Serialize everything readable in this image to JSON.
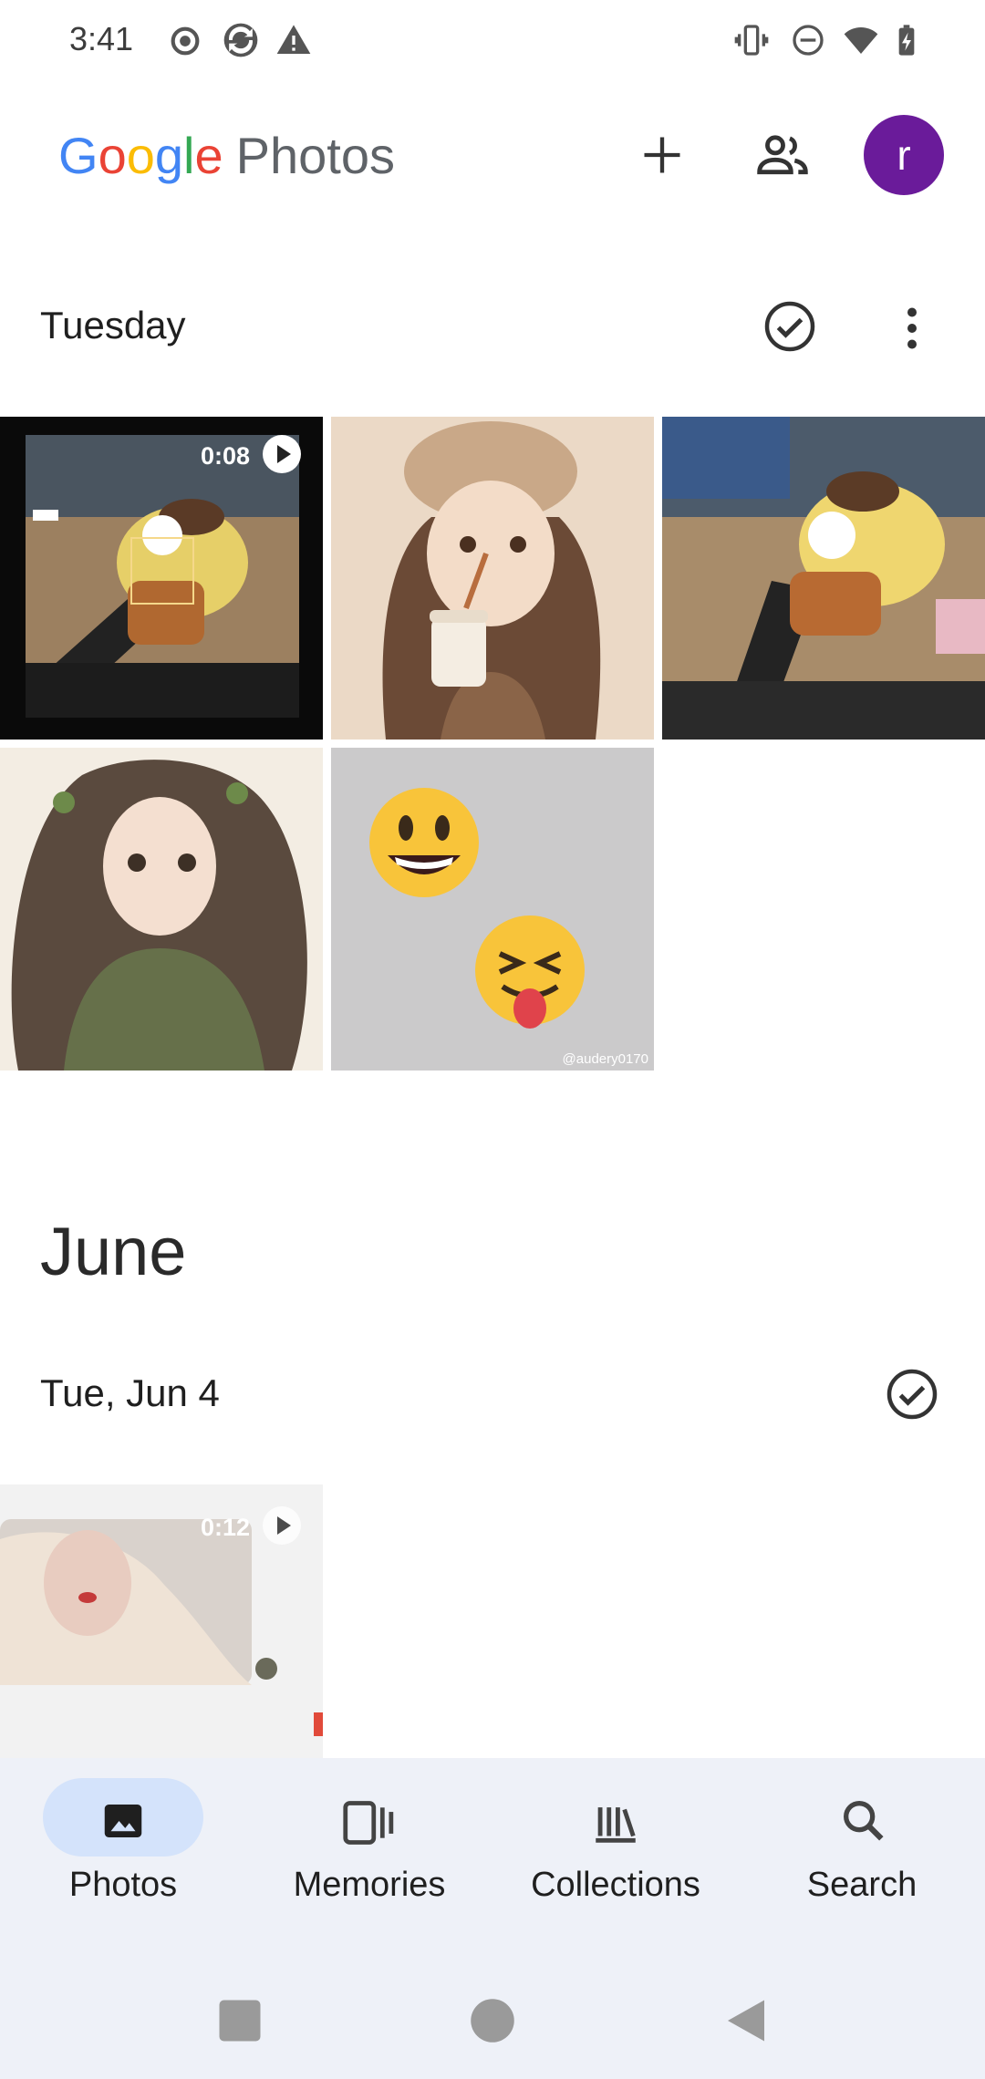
{
  "status_bar": {
    "time": "3:41",
    "left_icons": [
      "record-icon",
      "sync-icon",
      "warning-icon"
    ],
    "right_icons": [
      "vibrate-icon",
      "dnd-icon",
      "wifi-icon",
      "battery-charging-icon"
    ]
  },
  "header": {
    "logo_google": [
      "G",
      "o",
      "o",
      "g",
      "l",
      "e"
    ],
    "logo_photos": "Photos",
    "add_icon": "plus-icon",
    "share_icon": "people-icon",
    "avatar_letter": "r",
    "avatar_color": "#6a1b9a"
  },
  "sections": [
    {
      "date_label": "Tuesday",
      "items": [
        {
          "type": "video",
          "duration": "0:08",
          "desc": "yellow plush toy on desk"
        },
        {
          "type": "photo",
          "desc": "girl with cap drinking coffee illustration"
        },
        {
          "type": "photo",
          "desc": "yellow plush toy on keyboard"
        },
        {
          "type": "photo",
          "desc": "girl with long hair illustration"
        },
        {
          "type": "photo",
          "desc": "emoji faces",
          "watermark": "@audery0170"
        }
      ]
    },
    {
      "month_label": "June",
      "date_label": "Tue, Jun 4",
      "items": [
        {
          "type": "video",
          "duration": "0:12",
          "desc": "portrait video"
        }
      ]
    }
  ],
  "bottom_nav": [
    {
      "label": "Photos",
      "icon": "photo-icon",
      "active": true
    },
    {
      "label": "Memories",
      "icon": "memories-icon",
      "active": false
    },
    {
      "label": "Collections",
      "icon": "collections-icon",
      "active": false
    },
    {
      "label": "Search",
      "icon": "search-icon",
      "active": false
    }
  ],
  "colors": {
    "accent_pill": "#d4e3fb",
    "nav_bg": "#eef1f8"
  }
}
